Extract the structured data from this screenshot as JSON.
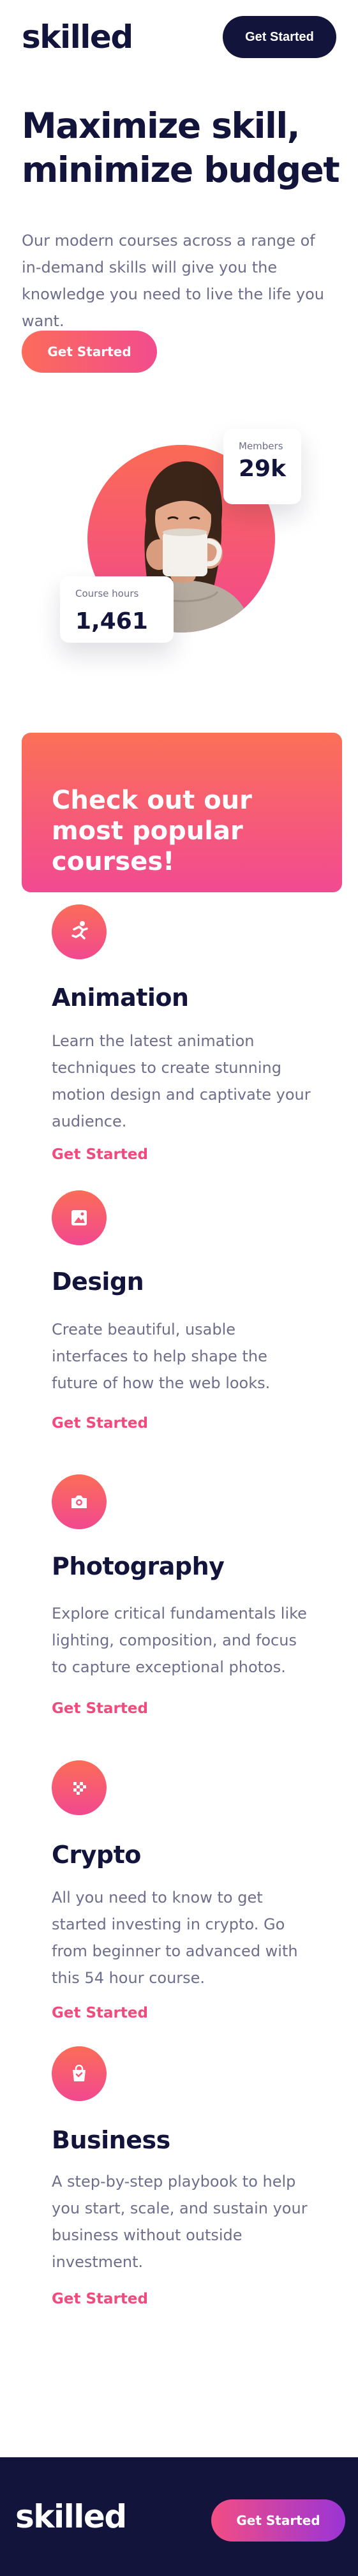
{
  "header": {
    "logo": "skilled",
    "cta_label": "Get Started"
  },
  "hero": {
    "title_line1": "Maximize skill,",
    "title_line2": "minimize budget",
    "description": "Our modern courses across a range of in-demand skills will give you the knowledge you need to live the life you want.",
    "cta_label": "Get Started",
    "stats": {
      "members_label": "Members",
      "members_value": "29k",
      "hours_label": "Course hours",
      "hours_value": "1,461"
    }
  },
  "promo": {
    "title": "Check out our most popular courses!"
  },
  "courses": [
    {
      "icon": "running-icon",
      "title": "Animation",
      "description": "Learn the latest animation techniques to create stunning motion design and captivate your audience.",
      "link": "Get Started"
    },
    {
      "icon": "image-icon",
      "title": "Design",
      "description": "Create beautiful, usable interfaces to help shape the future of how the web looks.",
      "link": "Get Started"
    },
    {
      "icon": "camera-icon",
      "title": "Photography",
      "description": "Explore critical fundamentals like lighting, composition, and focus to capture exceptional photos.",
      "link": "Get Started"
    },
    {
      "icon": "crypto-icon",
      "title": "Crypto",
      "description": "All you need to know to get started investing in crypto. Go from beginner to advanced with this 54 hour course.",
      "link": "Get Started"
    },
    {
      "icon": "shopping-bag-icon",
      "title": "Business",
      "description": "A step-by-step playbook to help you start, scale, and sustain your business without outside investment.",
      "link": "Get Started"
    }
  ],
  "footer": {
    "logo": "skilled",
    "cta_label": "Get Started"
  },
  "colors": {
    "navy": "#12143b",
    "gray_text": "#6c6e8c",
    "gradient_start": "#fb6c5a",
    "gradient_end": "#f24a8e",
    "link": "#f24a7c",
    "footer_gradient_end": "#9a34d6"
  }
}
